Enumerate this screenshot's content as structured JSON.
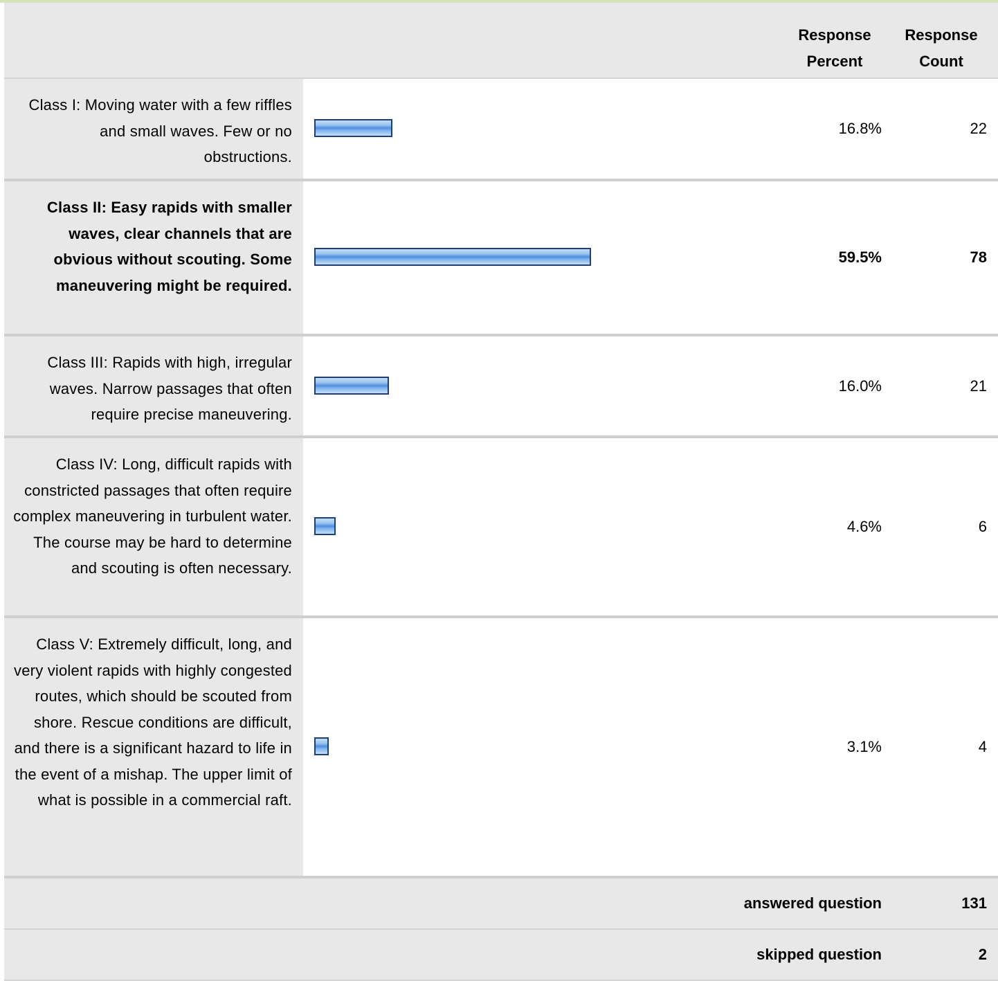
{
  "header": {
    "percent_label": "Response Percent",
    "count_label": "Response Count"
  },
  "rows": [
    {
      "label": "Class I: Moving water with a few riffles and small waves. Few or no obstructions.",
      "percent": "16.8%",
      "count": "22",
      "fraction": 0.168,
      "bold": false
    },
    {
      "label": "Class II: Easy rapids with smaller waves, clear channels that are obvious without scouting. Some maneuvering might be required.",
      "percent": "59.5%",
      "count": "78",
      "fraction": 0.595,
      "bold": true
    },
    {
      "label": "Class III: Rapids with high, irregular waves. Narrow passages that often require precise maneuvering.",
      "percent": "16.0%",
      "count": "21",
      "fraction": 0.16,
      "bold": false
    },
    {
      "label": "Class IV: Long, difficult rapids with constricted passages that often require complex maneuvering in turbulent water. The course may be hard to determine and scouting is often necessary.",
      "percent": "4.6%",
      "count": "6",
      "fraction": 0.046,
      "bold": false
    },
    {
      "label": "Class V: Extremely difficult, long, and very violent rapids with highly congested routes, which should be scouted from shore. Rescue conditions are difficult, and there is a significant hazard to life in the event of a mishap. The upper limit of what is possible in a commercial raft.",
      "percent": "3.1%",
      "count": "4",
      "fraction": 0.031,
      "bold": false
    }
  ],
  "footer": {
    "answered_label": "answered question",
    "answered_value": "131",
    "skipped_label": "skipped question",
    "skipped_value": "2"
  },
  "colors": {
    "bar_fill": "#7fb2ec",
    "bar_border": "#1f3f73",
    "label_bg": "#e8e8e8",
    "top_accent": "#d7e3b8"
  }
}
